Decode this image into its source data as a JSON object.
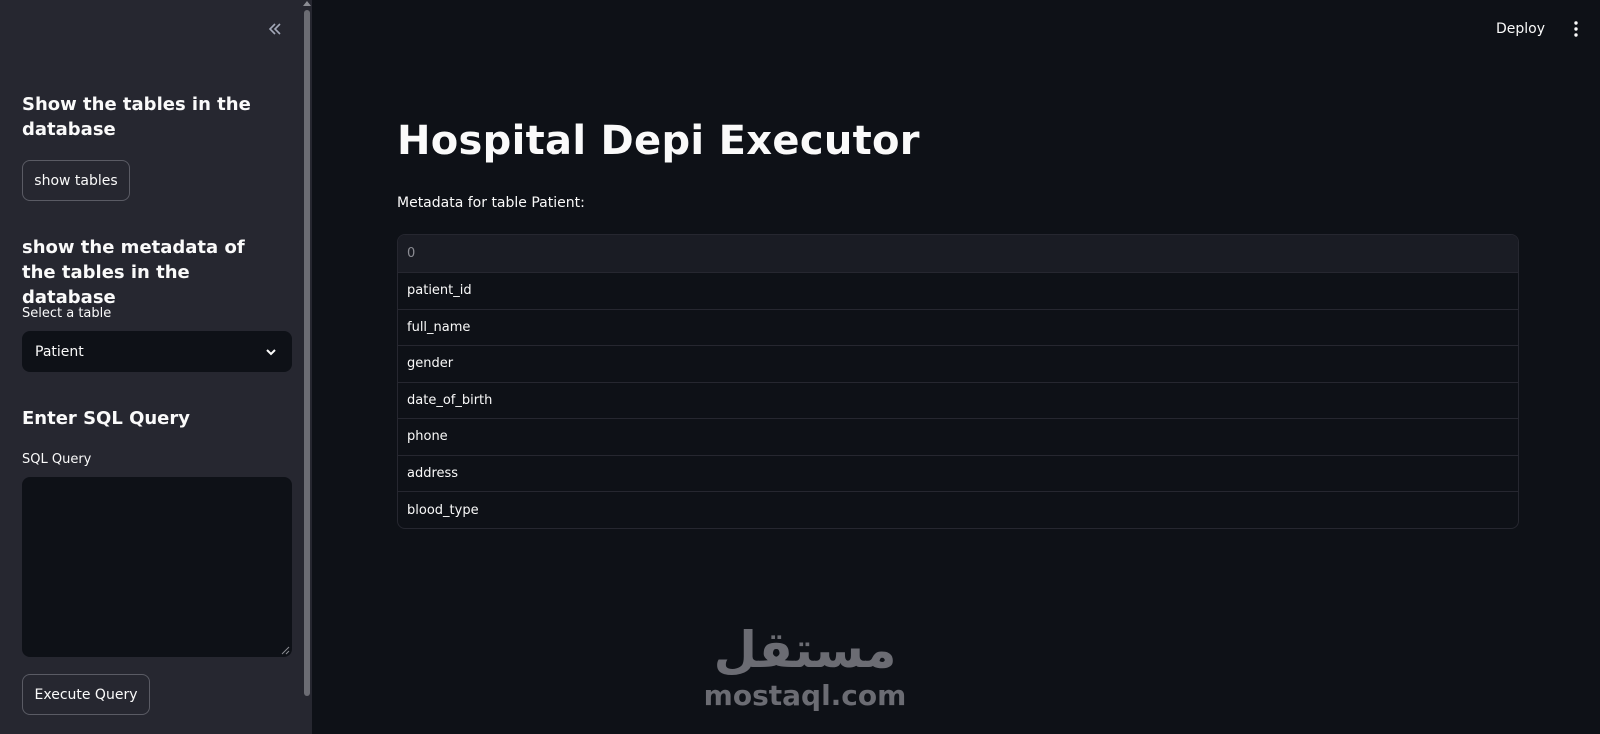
{
  "sidebar": {
    "collapse_icon": "double-chevron-left-icon",
    "section1_heading": "Show the tables in the database",
    "show_tables_label": "show tables",
    "section2_heading": "show the metadata of the tables in the database",
    "select_label": "Select a table",
    "select_value": "Patient",
    "section3_heading": "Enter SQL Query",
    "query_label": "SQL Query",
    "query_value": "",
    "execute_label": "Execute Query"
  },
  "header": {
    "deploy_label": "Deploy",
    "menu_icon": "kebab-menu-icon"
  },
  "main": {
    "title": "Hospital Depi Executor",
    "caption": "Metadata for table Patient:",
    "table": {
      "column_header": "0",
      "rows": [
        "patient_id",
        "full_name",
        "gender",
        "date_of_birth",
        "phone",
        "address",
        "blood_type"
      ]
    }
  },
  "watermark": {
    "arabic": "مستقل",
    "latin": "mostaql.com"
  },
  "colors": {
    "sidebar_bg": "#262730",
    "main_bg": "#0e1117",
    "text": "#fafafa",
    "border": "#262730"
  }
}
